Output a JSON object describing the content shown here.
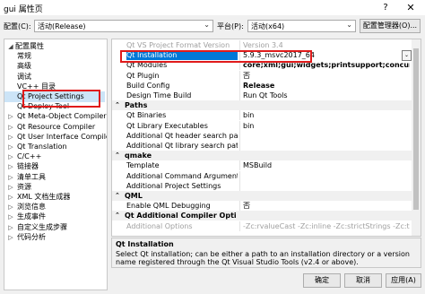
{
  "window": {
    "title": "gui 属性页",
    "help": "?",
    "close": "✕"
  },
  "toolbar": {
    "config_label": "配置(C):",
    "config_value": "活动(Release)",
    "platform_label": "平台(P):",
    "platform_value": "活动(x64)",
    "config_manager": "配置管理器(O)..."
  },
  "tree": [
    {
      "label": "配置属性",
      "level": 0,
      "arrow": "◢",
      "selected": false
    },
    {
      "label": "常规",
      "level": 1,
      "arrow": "",
      "selected": false
    },
    {
      "label": "高级",
      "level": 1,
      "arrow": "",
      "selected": false
    },
    {
      "label": "调试",
      "level": 1,
      "arrow": "",
      "selected": false
    },
    {
      "label": "VC++ 目录",
      "level": 1,
      "arrow": "",
      "selected": false
    },
    {
      "label": "Qt Project Settings",
      "level": 1,
      "arrow": "",
      "selected": true
    },
    {
      "label": "Qt Deploy Tool",
      "level": 1,
      "arrow": "",
      "selected": false
    },
    {
      "label": "Qt Meta-Object Compiler",
      "level": 1,
      "arrow": "▷",
      "selected": false
    },
    {
      "label": "Qt Resource Compiler",
      "level": 1,
      "arrow": "▷",
      "selected": false
    },
    {
      "label": "Qt User Interface Compiler",
      "level": 1,
      "arrow": "▷",
      "selected": false
    },
    {
      "label": "Qt Translation",
      "level": 1,
      "arrow": "▷",
      "selected": false
    },
    {
      "label": "C/C++",
      "level": 1,
      "arrow": "▷",
      "selected": false
    },
    {
      "label": "链接器",
      "level": 1,
      "arrow": "▷",
      "selected": false
    },
    {
      "label": "清单工具",
      "level": 1,
      "arrow": "▷",
      "selected": false
    },
    {
      "label": "资源",
      "level": 1,
      "arrow": "▷",
      "selected": false
    },
    {
      "label": "XML 文档生成器",
      "level": 1,
      "arrow": "▷",
      "selected": false
    },
    {
      "label": "浏览信息",
      "level": 1,
      "arrow": "▷",
      "selected": false
    },
    {
      "label": "生成事件",
      "level": 1,
      "arrow": "▷",
      "selected": false
    },
    {
      "label": "自定义生成步骤",
      "level": 1,
      "arrow": "▷",
      "selected": false
    },
    {
      "label": "代码分析",
      "level": 1,
      "arrow": "▷",
      "selected": false
    }
  ],
  "grid": [
    {
      "type": "prop",
      "name": "Qt VS Project Format Version",
      "value": "Version 3.4",
      "style": "faded"
    },
    {
      "type": "prop",
      "name": "Qt Installation",
      "value": "5.9.3_msvc2017_64",
      "style": "sel"
    },
    {
      "type": "prop",
      "name": "Qt Modules",
      "value": "core;xml;gui;widgets;printsupport;concurrent",
      "style": "bold"
    },
    {
      "type": "prop",
      "name": "Qt Plugin",
      "value": "否",
      "style": ""
    },
    {
      "type": "prop",
      "name": "Build Config",
      "value": "Release",
      "style": "bold"
    },
    {
      "type": "prop",
      "name": "Design Time Build",
      "value": "Run Qt Tools",
      "style": ""
    },
    {
      "type": "cat",
      "name": "Paths",
      "value": "",
      "style": ""
    },
    {
      "type": "prop",
      "name": "Qt Binaries",
      "value": "bin",
      "style": ""
    },
    {
      "type": "prop",
      "name": "Qt Library Executables",
      "value": "bin",
      "style": ""
    },
    {
      "type": "prop",
      "name": "Additional Qt header search paths",
      "value": "",
      "style": ""
    },
    {
      "type": "prop",
      "name": "Additional Qt library search paths",
      "value": "",
      "style": ""
    },
    {
      "type": "cat",
      "name": "qmake",
      "value": "",
      "style": ""
    },
    {
      "type": "prop",
      "name": "Template",
      "value": "MSBuild",
      "style": ""
    },
    {
      "type": "prop",
      "name": "Additional Command Arguments",
      "value": "",
      "style": ""
    },
    {
      "type": "prop",
      "name": "Additional Project Settings",
      "value": "",
      "style": ""
    },
    {
      "type": "cat",
      "name": "QML",
      "value": "",
      "style": ""
    },
    {
      "type": "prop",
      "name": "Enable QML Debugging",
      "value": "否",
      "style": ""
    },
    {
      "type": "cat",
      "name": "Qt Additional Compiler Options",
      "value": "",
      "style": ""
    },
    {
      "type": "prop",
      "name": "Additional Options",
      "value": "-Zc:rvalueCast -Zc:inline -Zc:strictStrings -Zc:throwingNew",
      "style": "faded"
    }
  ],
  "description": {
    "title": "Qt Installation",
    "text": "Select Qt installation; can be either a path to an installation directory or a version name registered through the Qt Visual Studio Tools (v2.4 or above)."
  },
  "buttons": {
    "ok": "确定",
    "cancel": "取消",
    "apply": "应用(A)"
  },
  "colors": {
    "selection": "#0078d7",
    "tree_selected": "#cce4f7",
    "annotation": "#e01b1b"
  }
}
